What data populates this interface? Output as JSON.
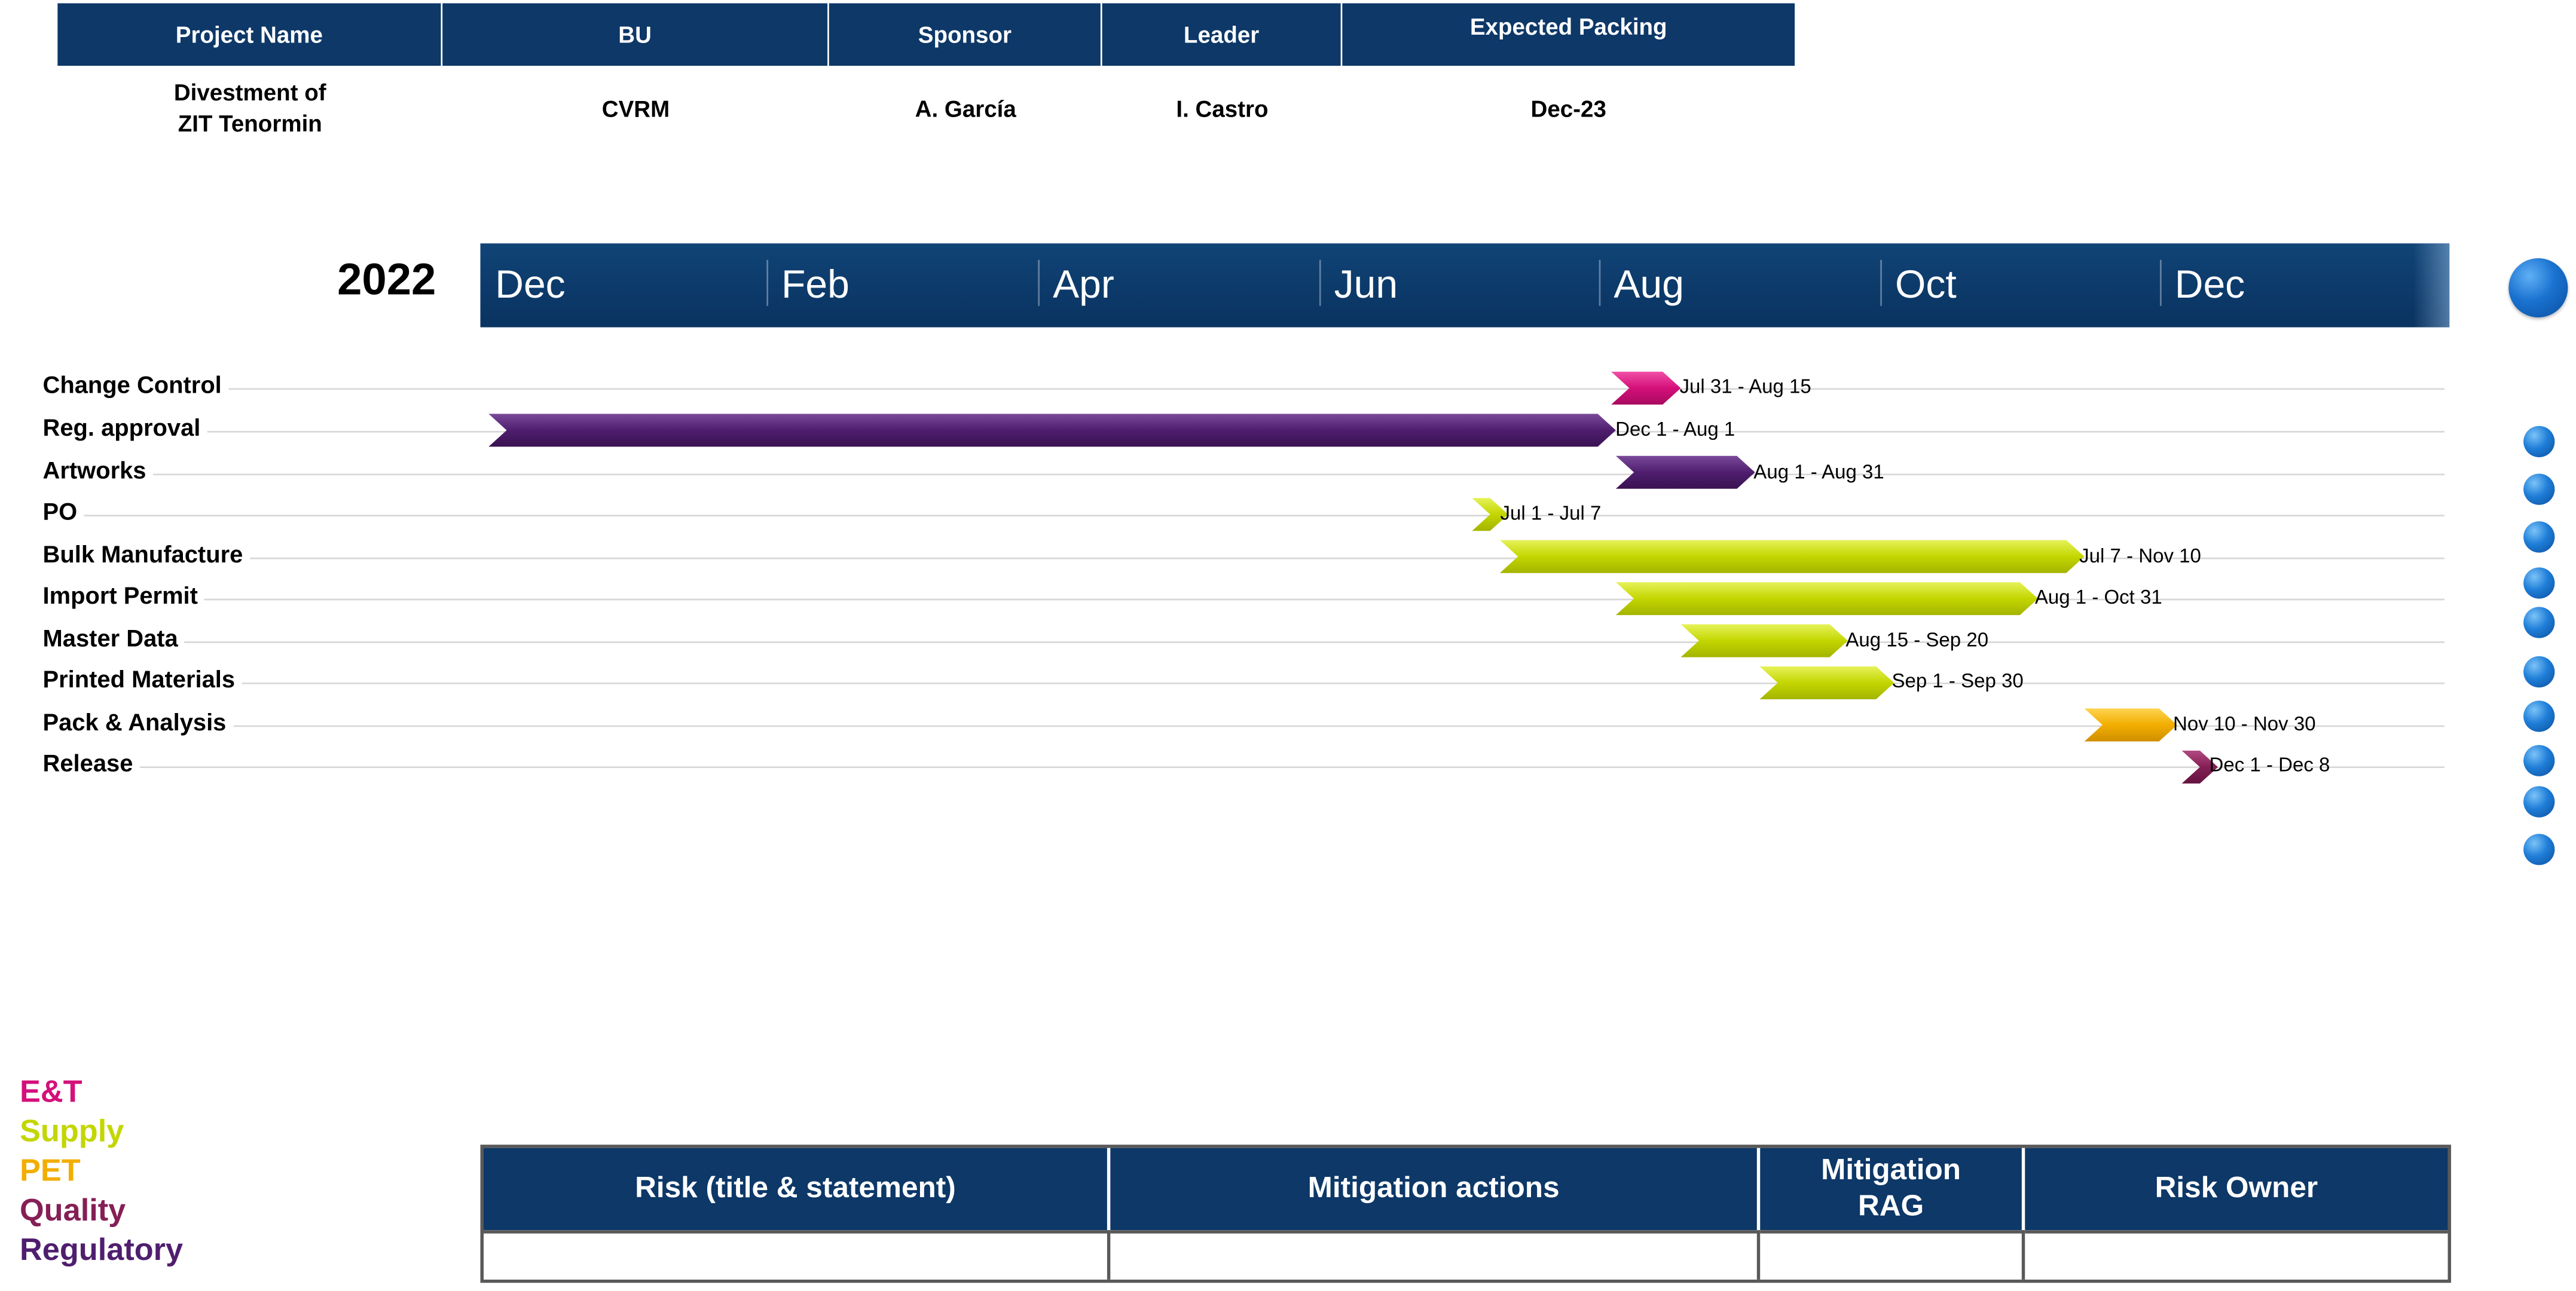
{
  "project_header": {
    "columns": [
      "Project Name",
      "BU",
      "Sponsor",
      "Leader",
      "Expected Packing"
    ],
    "values": [
      "Divestment of ZIT Tenormin",
      "CVRM",
      "A. García",
      "I. Castro",
      "Dec-23"
    ]
  },
  "timeline": {
    "year": "2022",
    "months": [
      "Dec",
      "Feb",
      "Apr",
      "Jun",
      "Aug",
      "Oct",
      "Dec"
    ]
  },
  "tasks": [
    {
      "name": "Change Control",
      "dates": "Jul 31 - Aug 15",
      "start": "2022-07-31",
      "end": "2022-08-15",
      "category": "E&T"
    },
    {
      "name": "Reg. approval",
      "dates": "Dec 1 - Aug 1",
      "start": "2021-12-01",
      "end": "2022-08-01",
      "category": "Regulatory"
    },
    {
      "name": "Artworks",
      "dates": "Aug 1 - Aug 31",
      "start": "2022-08-01",
      "end": "2022-08-31",
      "category": "Regulatory"
    },
    {
      "name": "PO",
      "dates": "Jul 1 - Jul 7",
      "start": "2022-07-01",
      "end": "2022-07-07",
      "category": "Supply"
    },
    {
      "name": "Bulk Manufacture",
      "dates": "Jul 7 - Nov 10",
      "start": "2022-07-07",
      "end": "2022-11-10",
      "category": "Supply"
    },
    {
      "name": "Import Permit",
      "dates": "Aug 1 - Oct 31",
      "start": "2022-08-01",
      "end": "2022-10-31",
      "category": "Supply"
    },
    {
      "name": "Master Data",
      "dates": "Aug 15 - Sep 20",
      "start": "2022-08-15",
      "end": "2022-09-20",
      "category": "Supply"
    },
    {
      "name": "Printed Materials",
      "dates": "Sep 1 - Sep 30",
      "start": "2022-09-01",
      "end": "2022-09-30",
      "category": "Supply"
    },
    {
      "name": "Pack & Analysis",
      "dates": "Nov 10 - Nov 30",
      "start": "2022-11-10",
      "end": "2022-11-30",
      "category": "PET"
    },
    {
      "name": "Release",
      "dates": "Dec 1 - Dec 8",
      "start": "2022-12-01",
      "end": "2022-12-08",
      "category": "Quality"
    }
  ],
  "legend": [
    {
      "label": "E&T",
      "color": "#d4107a"
    },
    {
      "label": "Supply",
      "color": "#c3d600"
    },
    {
      "label": "PET",
      "color": "#f2ae00"
    },
    {
      "label": "Quality",
      "color": "#851f55"
    },
    {
      "label": "Regulatory",
      "color": "#4f1e6e"
    }
  ],
  "risk_table": {
    "headers": [
      "Risk (title & statement)",
      "Mitigation actions",
      "Mitigation RAG",
      "Risk Owner"
    ],
    "rows": [
      [
        "",
        "",
        "",
        ""
      ]
    ]
  },
  "colors": {
    "header_navy": "#0d3868",
    "E&T": "#d4107a",
    "Supply": "#c3d600",
    "PET": "#f2ae00",
    "Quality": "#851f55",
    "Regulatory": "#4f1e6e"
  }
}
